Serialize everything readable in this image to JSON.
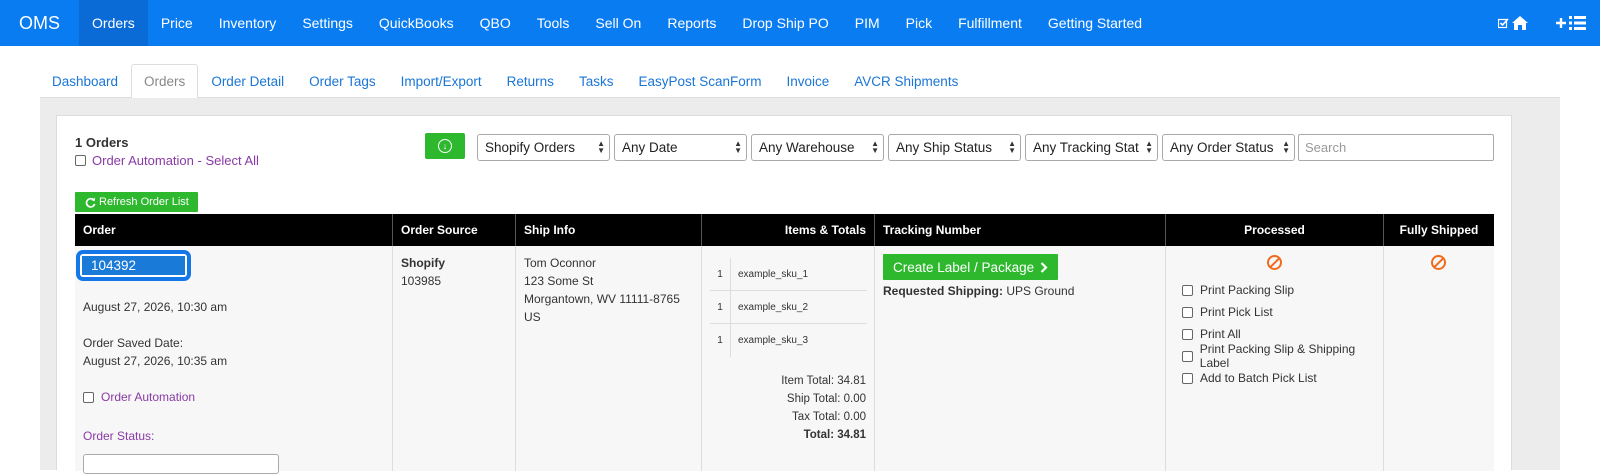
{
  "navbar": {
    "brand": "OMS",
    "items": [
      "Orders",
      "Price",
      "Inventory",
      "Settings",
      "QuickBooks",
      "QBO",
      "Tools",
      "Sell On",
      "Reports",
      "Drop Ship PO",
      "PIM",
      "Pick",
      "Fulfillment",
      "Getting Started"
    ],
    "active": "Orders",
    "right_icons": [
      "check-square-icon",
      "home-icon",
      "plus-icon",
      "list-icon"
    ]
  },
  "subtabs": {
    "items": [
      "Dashboard",
      "Orders",
      "Order Detail",
      "Order Tags",
      "Import/Export",
      "Returns",
      "Tasks",
      "EasyPost ScanForm",
      "Invoice",
      "AVCR Shipments"
    ],
    "active": "Orders"
  },
  "toolbar": {
    "orders_count": "1 Orders",
    "select_all_label": "Order Automation - Select All",
    "filters": [
      "Shopify Orders",
      "Any Date",
      "Any Warehouse",
      "Any Ship Status",
      "Any Tracking Status",
      "Any Order Status"
    ],
    "search_placeholder": "Search",
    "refresh_label": "Refresh Order List"
  },
  "table": {
    "headers": [
      "Order",
      "Order Source",
      "Ship Info",
      "Items & Totals",
      "Tracking Number",
      "Processed",
      "Fully Shipped"
    ],
    "row": {
      "order_id": "104392",
      "order_date": "August 27, 2026, 10:30 am",
      "saved_date_label": "Order Saved Date:",
      "saved_date": "August 27, 2026, 10:35 am",
      "automation_label": "Order Automation",
      "status_label": "Order Status:",
      "source_name": "Shopify",
      "source_id": "103985",
      "ship_name": "Tom Oconnor",
      "ship_street": "123 Some St",
      "ship_city": "Morgantown, WV 11111-8765",
      "ship_country": "US",
      "items": [
        {
          "qty": "1",
          "sku": "example_sku_1"
        },
        {
          "qty": "1",
          "sku": "example_sku_2"
        },
        {
          "qty": "1",
          "sku": "example_sku_3"
        }
      ],
      "item_total": "Item Total: 34.81",
      "ship_total": "Ship Total: 0.00",
      "tax_total": "Tax Total: 0.00",
      "total": "Total: 34.81",
      "create_label": "Create Label / Package",
      "requested_shipping_label": "Requested Shipping:",
      "requested_shipping_value": "UPS Ground",
      "process_options": [
        "Print Packing Slip",
        "Print Pick List",
        "Print All",
        "Print Packing Slip & Shipping Label",
        "Add to Batch Pick List"
      ]
    }
  },
  "colors": {
    "navbar": "#0a7cf2",
    "green_button": "#2eb82e",
    "purple_link": "#8a3aa6",
    "status_icon": "#f26a1b"
  }
}
